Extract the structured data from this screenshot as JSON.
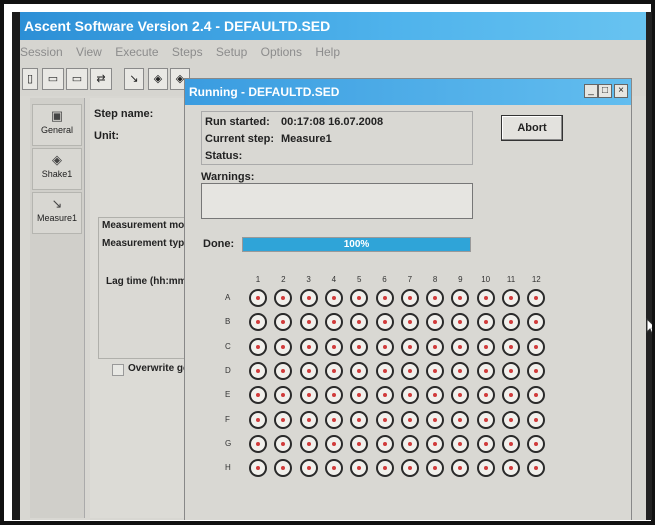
{
  "app": {
    "title": "Ascent Software Version 2.4    - DEFAULTD.SED",
    "menu": [
      "Session",
      "View",
      "Execute",
      "Steps",
      "Setup",
      "Options",
      "Help"
    ]
  },
  "sidebar": {
    "items": [
      {
        "label": "General",
        "icon": "general-step-icon"
      },
      {
        "label": "Shake1",
        "icon": "shake-step-icon"
      },
      {
        "label": "Measure1",
        "icon": "measure-step-icon"
      }
    ]
  },
  "step_panel": {
    "step_name_label": "Step name:",
    "unit_label": "Unit:",
    "measurement_mode_label": "Measurement mo",
    "measurement_type_label": "Measurement typ",
    "lag_time_label": "Lag time (hh:mm",
    "overwrite_label": "Overwrite ge"
  },
  "dialog": {
    "title": "Running - DEFAULTD.SED",
    "run_started_label": "Run started:",
    "run_started_value": "00:17:08 16.07.2008",
    "current_step_label": "Current step:",
    "current_step_value": "Measure1",
    "status_label": "Status:",
    "status_value": "",
    "warnings_label": "Warnings:",
    "abort_label": "Abort",
    "done_label": "Done:",
    "progress_percent": 100,
    "progress_text": "100%",
    "minimize": "_",
    "maximize": "□",
    "close": "×"
  },
  "plate": {
    "columns": [
      "1",
      "2",
      "3",
      "4",
      "5",
      "6",
      "7",
      "8",
      "9",
      "10",
      "11",
      "12"
    ],
    "rows": [
      "A",
      "B",
      "C",
      "D",
      "E",
      "F",
      "G",
      "H"
    ]
  }
}
